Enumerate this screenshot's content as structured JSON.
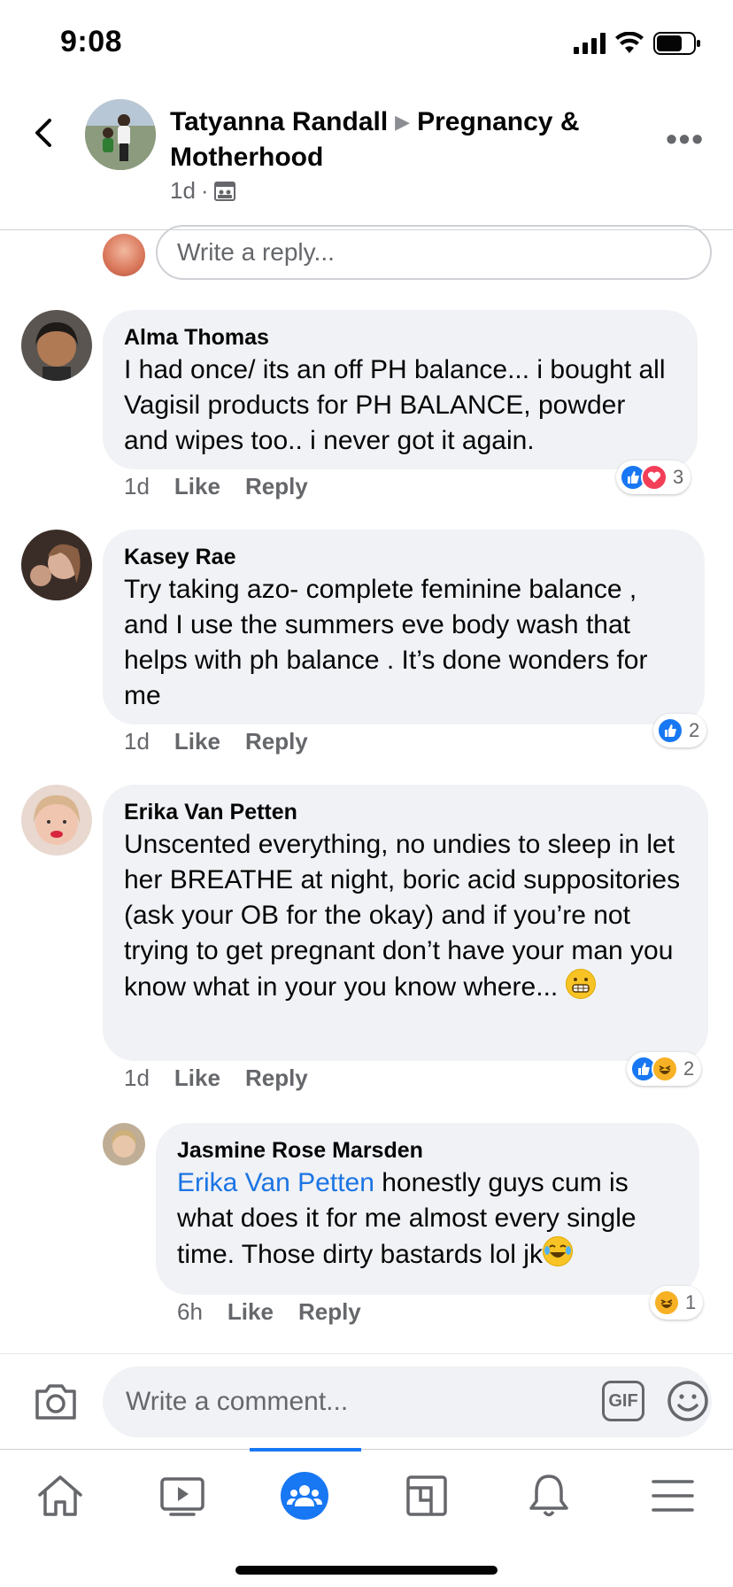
{
  "status_bar": {
    "time": "9:08"
  },
  "post": {
    "author": "Tatyanna Randall",
    "group": "Pregnancy & Motherhood",
    "time": "1d",
    "meta_sep": "·"
  },
  "reply_box": {
    "placeholder": "Write a reply..."
  },
  "comments": [
    {
      "name": "Alma Thomas",
      "text": "I had once/ its an off PH balance... i bought all Vagisil products for PH BALANCE, powder and wipes too.. i never got it again.",
      "time": "1d",
      "like": "Like",
      "reply": "Reply",
      "reactions": [
        "like-icon",
        "love-icon"
      ],
      "reaction_count": "3"
    },
    {
      "name": "Kasey Rae",
      "text": "Try taking azo- complete feminine balance , and I use the summers eve body wash that helps with ph balance . It’s done wonders for me",
      "time": "1d",
      "like": "Like",
      "reply": "Reply",
      "reactions": [
        "like-icon"
      ],
      "reaction_count": "2"
    },
    {
      "name": "Erika Van Petten",
      "text": "Unscented everything, no undies to sleep in let her BREATHE at night, boric acid suppositories (ask your OB for the okay) and if you’re not trying to get pregnant don’t have your man you know what in your you know where...",
      "emoji": "grimacing-face-emoji",
      "time": "1d",
      "like": "Like",
      "reply": "Reply",
      "reactions": [
        "like-icon",
        "haha-icon"
      ],
      "reaction_count": "2"
    },
    {
      "name": "Jasmine Rose Marsden",
      "mention": "Erika Van Petten",
      "text": " honestly guys cum is what does it for me almost every single time. Those dirty bastards lol jk",
      "emoji": "tears-of-joy-emoji",
      "time": "6h",
      "like": "Like",
      "reply": "Reply",
      "reactions": [
        "haha-icon"
      ],
      "reaction_count": "1"
    }
  ],
  "composer": {
    "placeholder": "Write a comment...",
    "gif_label": "GIF"
  },
  "tab_bar": {
    "tabs": [
      "home-icon",
      "watch-icon",
      "groups-icon",
      "pages-icon",
      "notifications-icon",
      "menu-icon"
    ],
    "active": "groups-icon"
  },
  "colors": {
    "accent": "#1877f2",
    "bubble": "#f0f2f5",
    "secondary_text": "#65676b",
    "love": "#f33e58",
    "haha": "#f7b125"
  }
}
